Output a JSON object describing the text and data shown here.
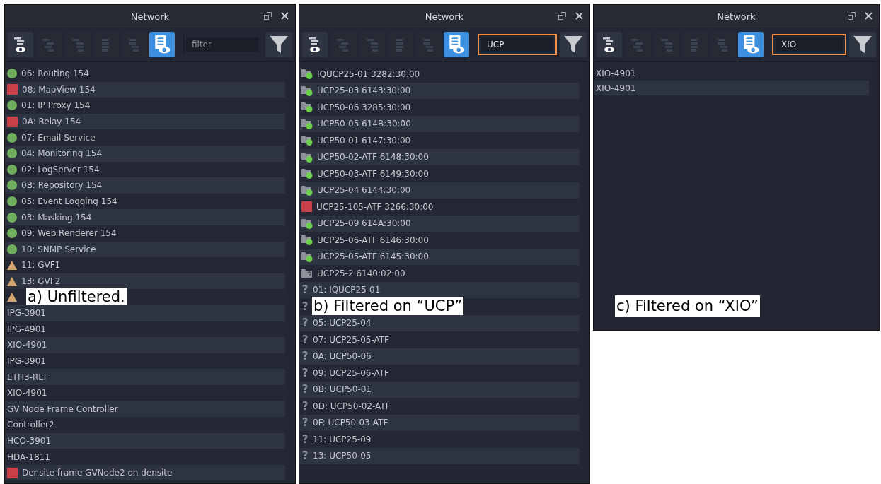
{
  "panels": [
    {
      "title": "Network",
      "caption": "a) Unfiltered.",
      "toolbar": [
        {
          "kind": "tree-eye",
          "selected": false,
          "disabled": false
        },
        {
          "kind": "tree",
          "selected": false,
          "disabled": true
        },
        {
          "kind": "tree-right",
          "selected": false,
          "disabled": true
        },
        {
          "kind": "tree-center",
          "selected": false,
          "disabled": true
        },
        {
          "kind": "tree-left",
          "selected": false,
          "disabled": true
        },
        {
          "kind": "list-eye",
          "selected": true,
          "disabled": false
        }
      ],
      "filter": {
        "placeholder": "filter",
        "highlighted": false
      },
      "rows": [
        {
          "kind": "ok",
          "text": "06: Routing 154"
        },
        {
          "kind": "error",
          "text": "08: MapView 154"
        },
        {
          "kind": "ok",
          "text": "01: IP Proxy 154"
        },
        {
          "kind": "error",
          "text": "0A: Relay 154"
        },
        {
          "kind": "ok",
          "text": "07: Email Service"
        },
        {
          "kind": "ok",
          "text": "04: Monitoring 154"
        },
        {
          "kind": "ok",
          "text": "02: LogServer 154"
        },
        {
          "kind": "ok",
          "text": "0B: Repository 154"
        },
        {
          "kind": "ok",
          "text": "05: Event Logging 154"
        },
        {
          "kind": "ok",
          "text": "03: Masking 154"
        },
        {
          "kind": "ok",
          "text": "09: Web Renderer 154"
        },
        {
          "kind": "ok",
          "text": "10: SNMP Service"
        },
        {
          "kind": "warning",
          "text": "11: GVF1"
        },
        {
          "kind": "warning",
          "text": "13: GVF2"
        },
        {
          "kind": "warning"
        },
        {
          "kind": "plain",
          "text": "IPG-3901"
        },
        {
          "kind": "plain",
          "text": "IPG-4901"
        },
        {
          "kind": "plain",
          "text": "XIO-4901"
        },
        {
          "kind": "plain",
          "text": "IPG-3901"
        },
        {
          "kind": "plain",
          "text": "ETH3-REF"
        },
        {
          "kind": "plain",
          "text": "XIO-4901"
        },
        {
          "kind": "plain",
          "text": "GV Node Frame Controller"
        },
        {
          "kind": "plain",
          "text": "Controller2"
        },
        {
          "kind": "plain",
          "text": "HCO-3901"
        },
        {
          "kind": "plain",
          "text": "HDA-1811"
        },
        {
          "kind": "error",
          "text": "Densite frame GVNode2 on densite"
        }
      ]
    },
    {
      "title": "Network",
      "caption": "b) Filtered on “UCP”",
      "toolbar": [
        {
          "kind": "tree-eye",
          "selected": false,
          "disabled": false
        },
        {
          "kind": "tree",
          "selected": false,
          "disabled": true
        },
        {
          "kind": "tree-right",
          "selected": false,
          "disabled": true
        },
        {
          "kind": "tree-center",
          "selected": false,
          "disabled": true
        },
        {
          "kind": "tree-left",
          "selected": false,
          "disabled": true
        },
        {
          "kind": "list-eye",
          "selected": true,
          "disabled": false
        }
      ],
      "filter": {
        "value": "UCP",
        "highlighted": true
      },
      "rows": [
        {
          "kind": "folder-ok",
          "text": "IQUCP25-01 3282:30:00"
        },
        {
          "kind": "folder-ok",
          "text": "UCP25-03 6143:30:00"
        },
        {
          "kind": "folder-ok",
          "text": "UCP50-06 3285:30:00"
        },
        {
          "kind": "folder-ok",
          "text": "UCP50-05 614B:30:00"
        },
        {
          "kind": "folder-ok",
          "text": "UCP50-01 6147:30:00"
        },
        {
          "kind": "folder-ok",
          "text": "UCP50-02-ATF 6148:30:00"
        },
        {
          "kind": "folder-ok",
          "text": "UCP50-03-ATF 6149:30:00"
        },
        {
          "kind": "folder-ok",
          "text": "UCP25-04 6144:30:00"
        },
        {
          "kind": "error",
          "text": "UCP25-105-ATF 3266:30:00"
        },
        {
          "kind": "folder-ok",
          "text": "UCP25-09 614A:30:00"
        },
        {
          "kind": "folder-ok",
          "text": "UCP25-06-ATF 6146:30:00"
        },
        {
          "kind": "folder-ok",
          "text": "UCP25-05-ATF 6145:30:00"
        },
        {
          "kind": "folder-unknown",
          "text": "UCP25-2 6140:02:00"
        },
        {
          "kind": "unknown",
          "mark": "?",
          "text": "01: IQUCP25-01"
        },
        {
          "kind": "unknown",
          "mark": "?"
        },
        {
          "kind": "unknown",
          "mark": "?",
          "text": "05: UCP25-04"
        },
        {
          "kind": "unknown",
          "mark": "?",
          "text": "07: UCP25-05-ATF"
        },
        {
          "kind": "unknown",
          "mark": "?",
          "text": "0A: UCP50-06"
        },
        {
          "kind": "unknown",
          "mark": "?",
          "text": "09: UCP25-06-ATF"
        },
        {
          "kind": "unknown",
          "mark": "?",
          "text": "0B: UCP50-01"
        },
        {
          "kind": "unknown",
          "mark": "?",
          "text": "0D: UCP50-02-ATF"
        },
        {
          "kind": "unknown",
          "mark": "?",
          "text": "0F: UCP50-03-ATF"
        },
        {
          "kind": "unknown",
          "mark": "?",
          "text": "11: UCP25-09"
        },
        {
          "kind": "unknown",
          "mark": "?",
          "text": "13: UCP50-05"
        }
      ]
    },
    {
      "title": "Network",
      "caption": "c) Filtered on “XIO”",
      "toolbar": [
        {
          "kind": "tree-eye",
          "selected": false,
          "disabled": false
        },
        {
          "kind": "tree",
          "selected": false,
          "disabled": true
        },
        {
          "kind": "tree-right",
          "selected": false,
          "disabled": true
        },
        {
          "kind": "tree-center",
          "selected": false,
          "disabled": true
        },
        {
          "kind": "tree-left",
          "selected": false,
          "disabled": true
        },
        {
          "kind": "list-eye",
          "selected": true,
          "disabled": false
        }
      ],
      "filter": {
        "value": "XIO",
        "highlighted": true
      },
      "rows": [
        {
          "kind": "plain",
          "text": "XIO-4901"
        },
        {
          "kind": "plain",
          "text": "XIO-4901"
        }
      ]
    }
  ]
}
